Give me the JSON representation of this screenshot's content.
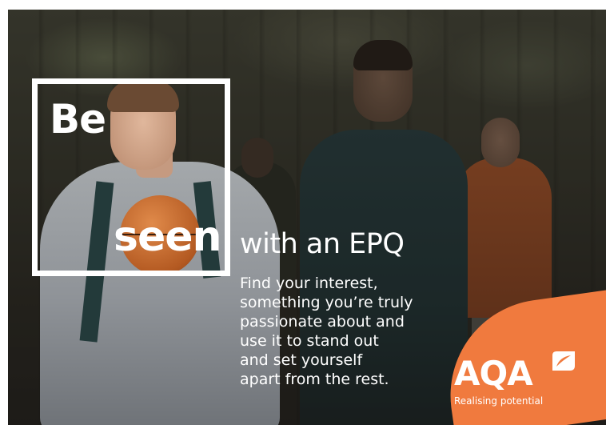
{
  "headline": {
    "word1": "Be",
    "word2": "seen",
    "rest": "with an EPQ"
  },
  "body_lines": [
    "Find your interest,",
    "something you’re truly",
    "passionate about and",
    "use it to stand out",
    "and set yourself",
    "apart from the rest."
  ],
  "brand": {
    "name": "AQA",
    "tagline": "Realising potential",
    "accent_color": "#f07a3e"
  },
  "icons": {
    "logo_mark": "aqa-leaf-icon"
  }
}
